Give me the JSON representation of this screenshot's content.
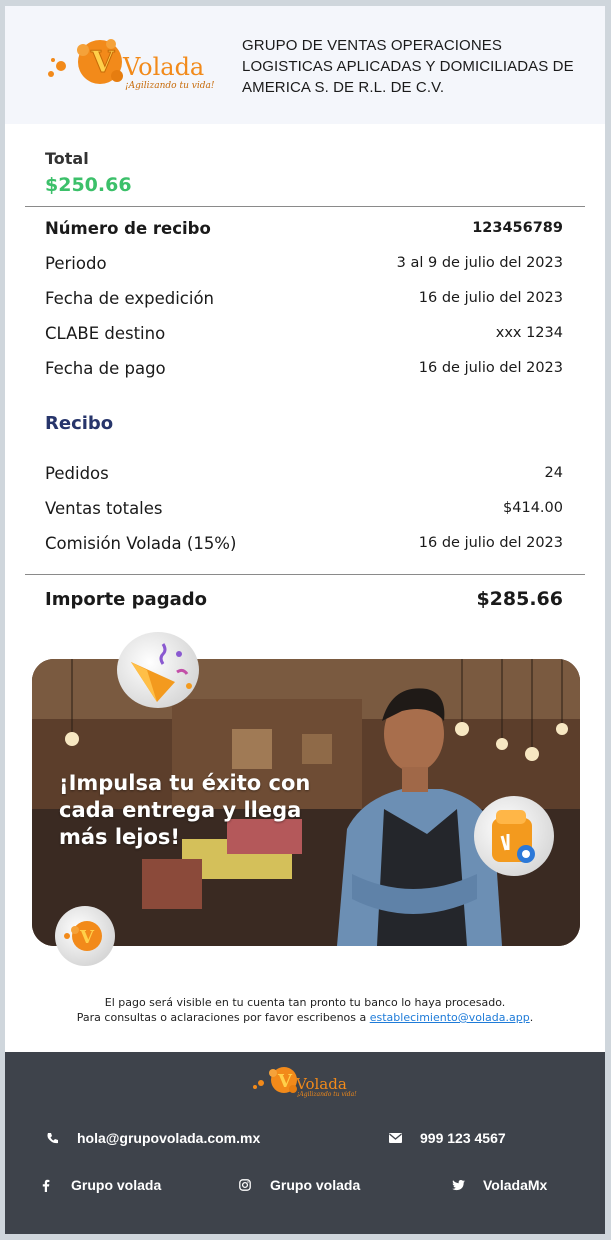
{
  "brand": {
    "logo_text": "Volada",
    "logo_tagline": "¡Agilizando tu vida!",
    "primary_color": "#f28a1a",
    "accent_green": "#3cc06a",
    "navy": "#27356b"
  },
  "header": {
    "company_name": "GRUPO DE VENTAS OPERACIONES LOGISTICAS APLICADAS Y DOMICILIADAS DE AMERICA S. DE R.L. DE C.V."
  },
  "total": {
    "label": "Total",
    "value": "$250.66"
  },
  "details": [
    {
      "label": "Número de recibo",
      "value": "123456789"
    },
    {
      "label": "Periodo",
      "value": "3 al 9 de julio del 2023"
    },
    {
      "label": "Fecha de expedición",
      "value": "16 de julio del 2023"
    },
    {
      "label": "CLABE destino",
      "value": "xxx 1234"
    },
    {
      "label": "Fecha de pago",
      "value": "16 de julio del 2023"
    }
  ],
  "receipt": {
    "title": "Recibo",
    "rows": [
      {
        "label": "Pedidos",
        "value": "24"
      },
      {
        "label": "Ventas totales",
        "value": "$414.00"
      },
      {
        "label": "Comisión Volada (15%)",
        "value": "16 de julio del 2023"
      }
    ],
    "paid_label": "Importe pagado",
    "paid_value": "$285.66"
  },
  "banner": {
    "headline": "¡Impulsa tu éxito con cada entrega y llega más lejos!"
  },
  "note": {
    "line1": "El pago será visible en tu cuenta tan pronto tu banco lo haya procesado.",
    "line2_prefix": "Para consultas o aclaraciones por favor escribenos a ",
    "email": "establecimiento@volada.app",
    "line2_suffix": "."
  },
  "footer": {
    "logo_text": "Volada",
    "logo_tagline": "¡Agilizando tu vida!",
    "email": "hola@grupovolada.com.mx",
    "phone": "999 123 4567",
    "facebook": "Grupo volada",
    "instagram": "Grupo volada",
    "twitter": "VoladaMx",
    "icons": [
      "phone-icon",
      "envelope-icon",
      "facebook-icon",
      "instagram-icon",
      "twitter-icon"
    ]
  }
}
